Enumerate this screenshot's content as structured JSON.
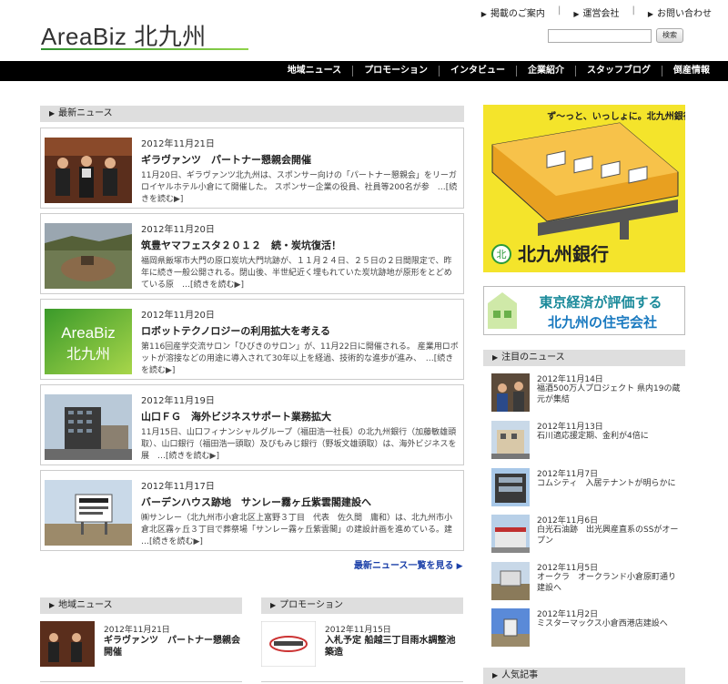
{
  "header": {
    "logo": "AreaBiz 北九州",
    "links": [
      "掲載のご案内",
      "運営会社",
      "お問い合わせ"
    ],
    "search_button": "検索"
  },
  "nav": [
    "地域ニュース",
    "プロモーション",
    "インタビュー",
    "企業紹介",
    "スタッフブログ",
    "倒産情報"
  ],
  "latest": {
    "heading": "最新ニュース",
    "more_link": "最新ニュース一覧を見る",
    "items": [
      {
        "date": "2012年11月21日",
        "title": "ギラヴァンツ　パートナー懇親会開催",
        "body": "11月20日、ギラヴァンツ北九州は、スポンサー向けの「パートナー懇親会」をリーガロイヤルホテル小倉にて開催した。 スポンサー企業の役員、社員等200名が参　",
        "more": "…[続きを読む▶]"
      },
      {
        "date": "2012年11月20日",
        "title": "筑豊ヤマフェスタ２０１２　続・炭坑復活！",
        "body": "福岡県飯塚市大門の原口炭坑大門坑跡が、１１月２４日、２５日の２日間限定で、昨年に続き一般公開される。閉山後、半世紀近く埋もれていた炭坑跡地が原形をとどめている原　",
        "more": "…[続きを読む▶]"
      },
      {
        "date": "2012年11月20日",
        "title": "ロボットテクノロジーの利用拡大を考える",
        "body": "第116回産学交流サロン「ひびきのサロン」が、11月22日に開催される。 産業用ロボットが溶接などの用途に導入されて30年以上を経過、技術的な進歩が進み、　",
        "more": "…[続きを読む▶]"
      },
      {
        "date": "2012年11月19日",
        "title": "山口ＦＧ　海外ビジネスサポート業務拡大",
        "body": "11月15日、山口フィナンシャルグループ（福田浩一社長）の北九州銀行（加藤敏雄頭取）、山口銀行（福田浩一頭取）及びもみじ銀行（野坂文雄頭取）は、海外ビジネスを展　",
        "more": "…[続きを読む▶]"
      },
      {
        "date": "2012年11月17日",
        "title": "バーデンハウス跡地　サンレー霧ヶ丘紫雲閣建設へ",
        "body": "㈱サンレー（北九州市小倉北区上富野３丁目　代表　佐久間　庸和）は、北九州市小倉北区霧ヶ丘３丁目で葬祭場「サンレー霧ヶ丘紫雲閣」の建設計画を進めている。建　",
        "more": "…[続きを読む▶]"
      }
    ]
  },
  "banner1": {
    "slogan": "ず〜っと、いっしょに。北九州銀行",
    "bank": "北九州銀行"
  },
  "banner2": {
    "line1": "東京経済が評価する",
    "line2": "北九州の住宅会社"
  },
  "featured": {
    "heading": "注目のニュース",
    "items": [
      {
        "date": "2012年11月14日",
        "text": "福酒500万人プロジェクト 県内19の蔵元が集結"
      },
      {
        "date": "2012年11月13日",
        "text": "石川適応援定期、金利が4倍に"
      },
      {
        "date": "2012年11月7日",
        "text": "コムシティ　入居テナントが明らかに"
      },
      {
        "date": "2012年11月6日",
        "text": "白光石油跡　出光興産直系のSSがオープン"
      },
      {
        "date": "2012年11月5日",
        "text": "オークラ　オークランド小倉原町通り建設へ"
      },
      {
        "date": "2012年11月2日",
        "text": "ミスターマックス小倉西港店建設へ"
      }
    ]
  },
  "popular": {
    "heading": "人気記事"
  },
  "regional": {
    "heading": "地域ニュース",
    "item": {
      "date": "2012年11月21日",
      "title": "ギラヴァンツ　パートナー懇親会開催"
    }
  },
  "promotion": {
    "heading": "プロモーション",
    "item": {
      "date": "2012年11月15日",
      "title": "入札予定 船越三丁目雨水調整池築造"
    }
  }
}
